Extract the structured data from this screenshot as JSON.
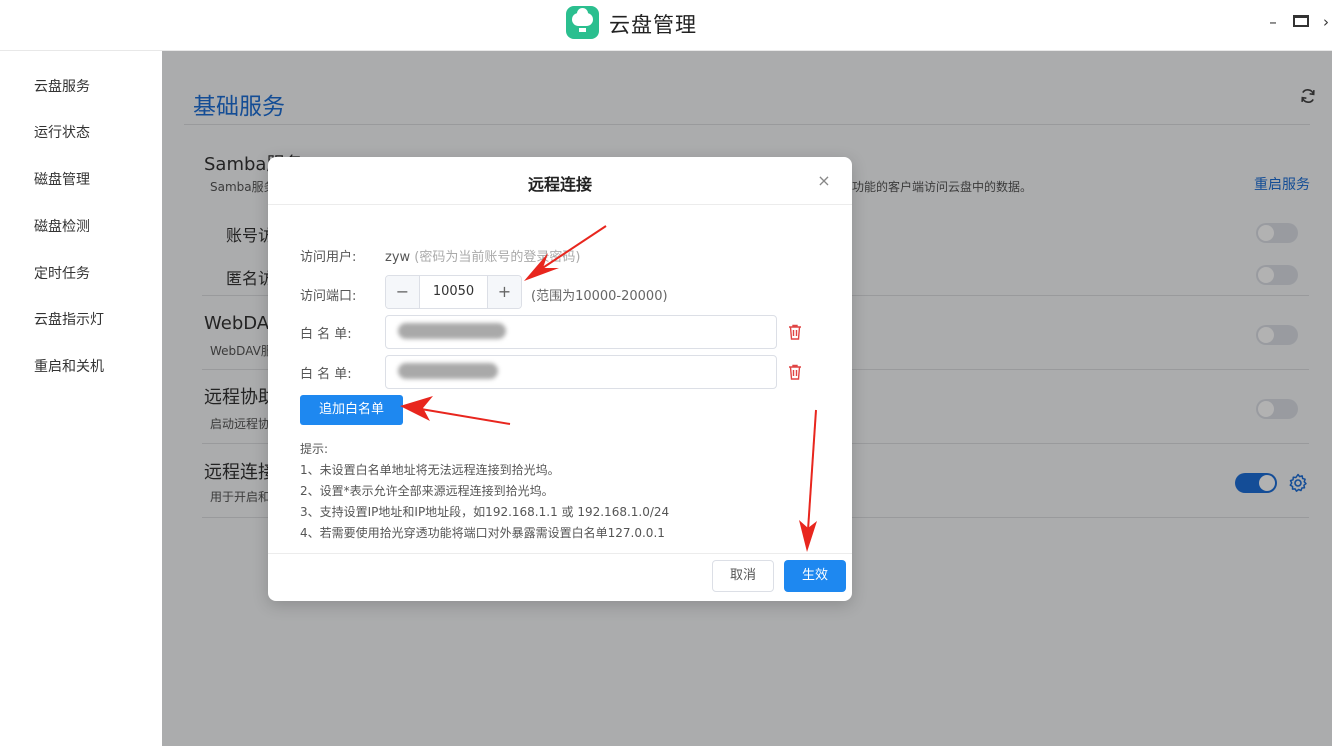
{
  "window": {
    "title": "云盘管理",
    "minimize": "–",
    "close": "›"
  },
  "sidebar": {
    "items": [
      {
        "label": "云盘服务"
      },
      {
        "label": "运行状态"
      },
      {
        "label": "磁盘管理"
      },
      {
        "label": "磁盘检测"
      },
      {
        "label": "定时任务"
      },
      {
        "label": "云盘指示灯"
      },
      {
        "label": "重启和关机"
      }
    ]
  },
  "main": {
    "title": "基础服务",
    "samba": {
      "name": "Samba服务",
      "desc_left": "Samba服务",
      "desc_right": "功能的客户端访问云盘中的数据。",
      "restart_link": "重启服务",
      "account_label": "账号访问",
      "anon_label": "匿名访问",
      "account_enabled": false,
      "anon_enabled": false
    },
    "webdav": {
      "name": "WebDAV服务",
      "desc": "WebDAV服务",
      "enabled": false
    },
    "remote_assist": {
      "name": "远程协助",
      "desc": "启动远程协助",
      "enabled": false
    },
    "remote_conn": {
      "name": "远程连接",
      "desc": "用于开启和",
      "enabled": true
    }
  },
  "dialog": {
    "title": "远程连接",
    "close": "×",
    "user_label": "访问用户:",
    "user_value": "zyw",
    "user_note": "(密码为当前账号的登录密码)",
    "port_label": "访问端口:",
    "port_value": "10050",
    "port_minus": "−",
    "port_plus": "+",
    "port_range": "(范围为10000-20000)",
    "whitelist_label": "白 名 单:",
    "whitelist": [
      {
        "value": ""
      },
      {
        "value": ""
      }
    ],
    "add_button": "追加白名单",
    "tips": [
      "提示:",
      "1、未设置白名单地址将无法远程连接到拾光坞。",
      "2、设置*表示允许全部来源远程连接到拾光坞。",
      "3、支持设置IP地址和IP地址段，如192.168.1.1 或 192.168.1.0/24",
      "4、若需要使用拾光穿透功能将端口对外暴露需设置白名单127.0.0.1"
    ],
    "cancel": "取消",
    "ok": "生效"
  },
  "colors": {
    "accent": "#1e88f0",
    "title_blue": "#1d6fd6",
    "danger": "#e04444",
    "logo": "#2bbf8f"
  }
}
